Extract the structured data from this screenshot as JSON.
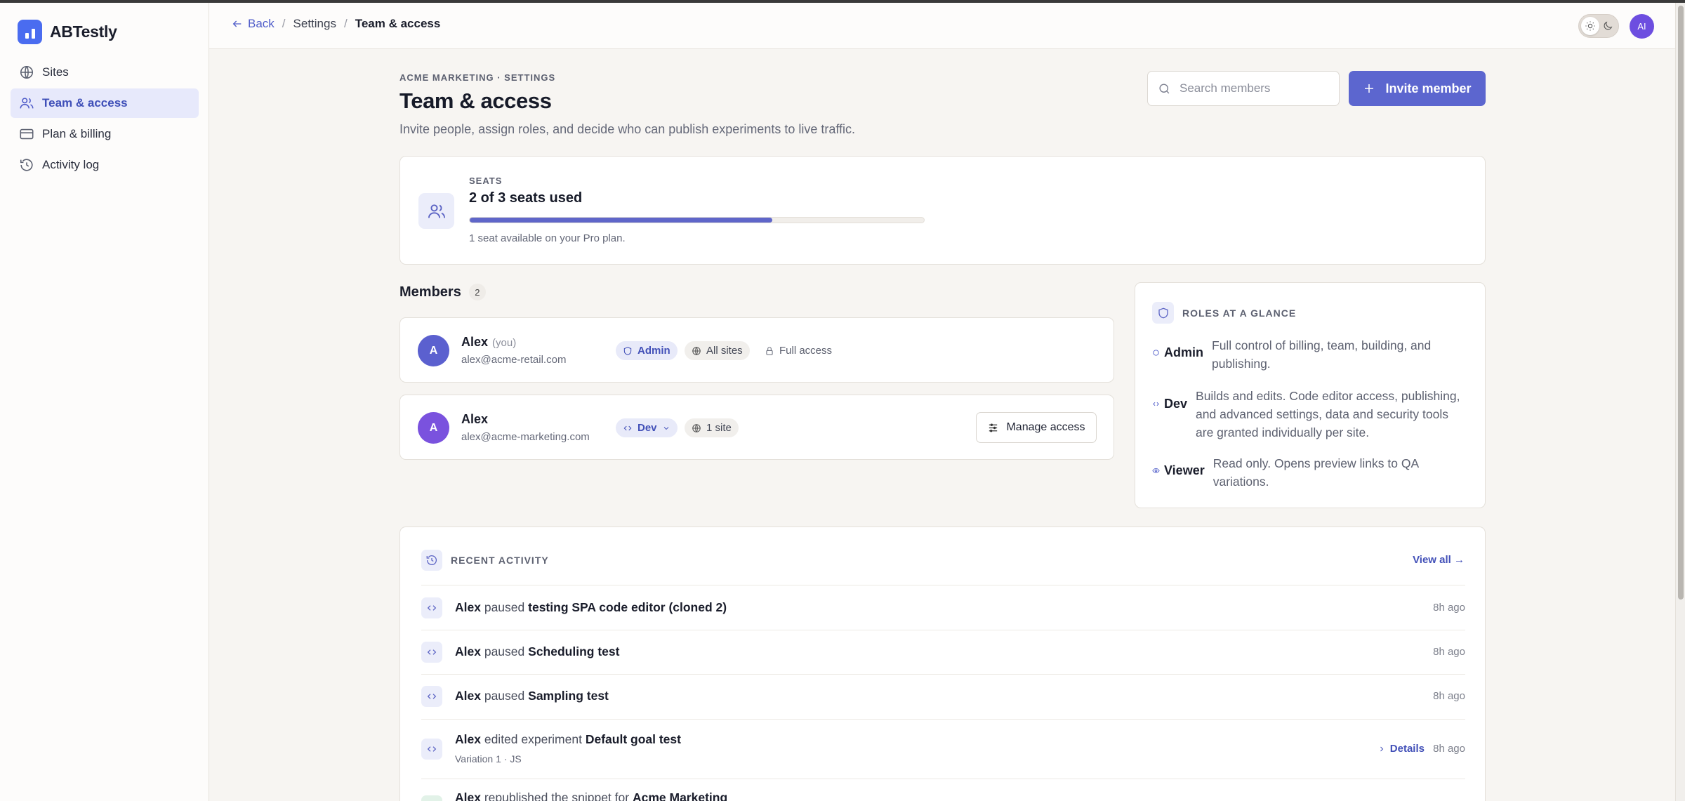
{
  "app": {
    "name": "ABTestly"
  },
  "sidebar": {
    "items": [
      {
        "label": "Sites",
        "icon": "globe-icon"
      },
      {
        "label": "Team & access",
        "icon": "users-icon",
        "active": true
      },
      {
        "label": "Plan & billing",
        "icon": "credit-card-icon"
      },
      {
        "label": "Activity log",
        "icon": "history-icon"
      }
    ]
  },
  "topbar": {
    "back": "Back",
    "crumb_settings": "Settings",
    "crumb_current": "Team & access",
    "avatar_initials": "AI"
  },
  "header": {
    "eyebrow": "ACME MARKETING · SETTINGS",
    "title": "Team & access",
    "subtitle": "Invite people, assign roles, and decide who can publish experiments to live traffic.",
    "search_placeholder": "Search members",
    "invite_label": "Invite member"
  },
  "seats": {
    "label": "SEATS",
    "title": "2 of 3 seats used",
    "used": 2,
    "total": 3,
    "note": "1 seat available on your Pro plan."
  },
  "members": {
    "title": "Members",
    "count": "2",
    "list": [
      {
        "initial": "A",
        "name": "Alex",
        "you": "(you)",
        "email": "alex@acme-retail.com",
        "role": "Admin",
        "scope": "All sites",
        "access": "Full access",
        "avatar_color": "#5b60cf"
      },
      {
        "initial": "A",
        "name": "Alex",
        "email": "alex@acme-marketing.com",
        "role": "Dev",
        "scope": "1 site",
        "action": "Manage access",
        "avatar_color": "#7a52de"
      }
    ]
  },
  "roles": {
    "title": "ROLES AT A GLANCE",
    "items": [
      {
        "name": "Admin",
        "desc": "Full control of billing, team, building, and publishing."
      },
      {
        "name": "Dev",
        "desc": "Builds and edits. Code editor access, publishing, and advanced settings, data and security tools are granted individually per site."
      },
      {
        "name": "Viewer",
        "desc": "Read only. Opens preview links to QA variations."
      }
    ]
  },
  "activity": {
    "title": "RECENT ACTIVITY",
    "view_all": "View all →",
    "rows": [
      {
        "actor": "Alex",
        "verb": "paused",
        "target": "testing SPA code editor (cloned 2)",
        "time": "8h ago"
      },
      {
        "actor": "Alex",
        "verb": "paused",
        "target": "Scheduling test",
        "time": "8h ago"
      },
      {
        "actor": "Alex",
        "verb": "paused",
        "target": "Sampling test",
        "time": "8h ago"
      },
      {
        "actor": "Alex",
        "verb": "edited experiment",
        "target": "Default goal test",
        "sub": "Variation 1 · JS",
        "details": "Details",
        "time": "8h ago"
      },
      {
        "actor": "Alex",
        "verb": "republished the snippet for",
        "target": "Acme Marketing",
        "time": ""
      }
    ]
  },
  "colors": {
    "accent": "#5c66cf",
    "brand": "#4a6cf0"
  }
}
